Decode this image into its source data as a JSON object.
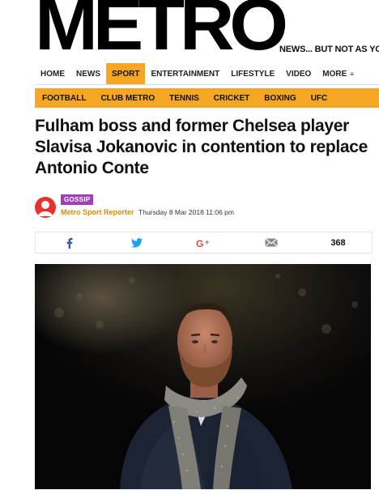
{
  "masthead": {
    "logo": "METRO",
    "tagline": "NEWS... BUT NOT AS YOU KNOW IT"
  },
  "main_nav": [
    {
      "label": "HOME"
    },
    {
      "label": "NEWS"
    },
    {
      "label": "SPORT",
      "active": true
    },
    {
      "label": "ENTERTAINMENT"
    },
    {
      "label": "LIFESTYLE"
    },
    {
      "label": "VIDEO"
    },
    {
      "label": "MORE"
    }
  ],
  "sub_nav": [
    "FOOTBALL",
    "CLUB METRO",
    "TENNIS",
    "CRICKET",
    "BOXING",
    "UFC"
  ],
  "article": {
    "headline": "Fulham boss and former Chelsea player Slavisa Jokanovic in contention to replace Antonio Conte",
    "category_badge": "GOSSIP",
    "author": "Metro Sport Reporter",
    "date": "Thursday 8 Mar 2018 11:06 pm"
  },
  "share": {
    "count": "368",
    "icons": [
      "facebook-icon",
      "twitter-icon",
      "google-plus-icon",
      "email-icon"
    ]
  },
  "colors": {
    "accent": "#f5a623",
    "badge": "#a03fb9",
    "author": "#e08a00",
    "avatar": "#e8312f"
  }
}
